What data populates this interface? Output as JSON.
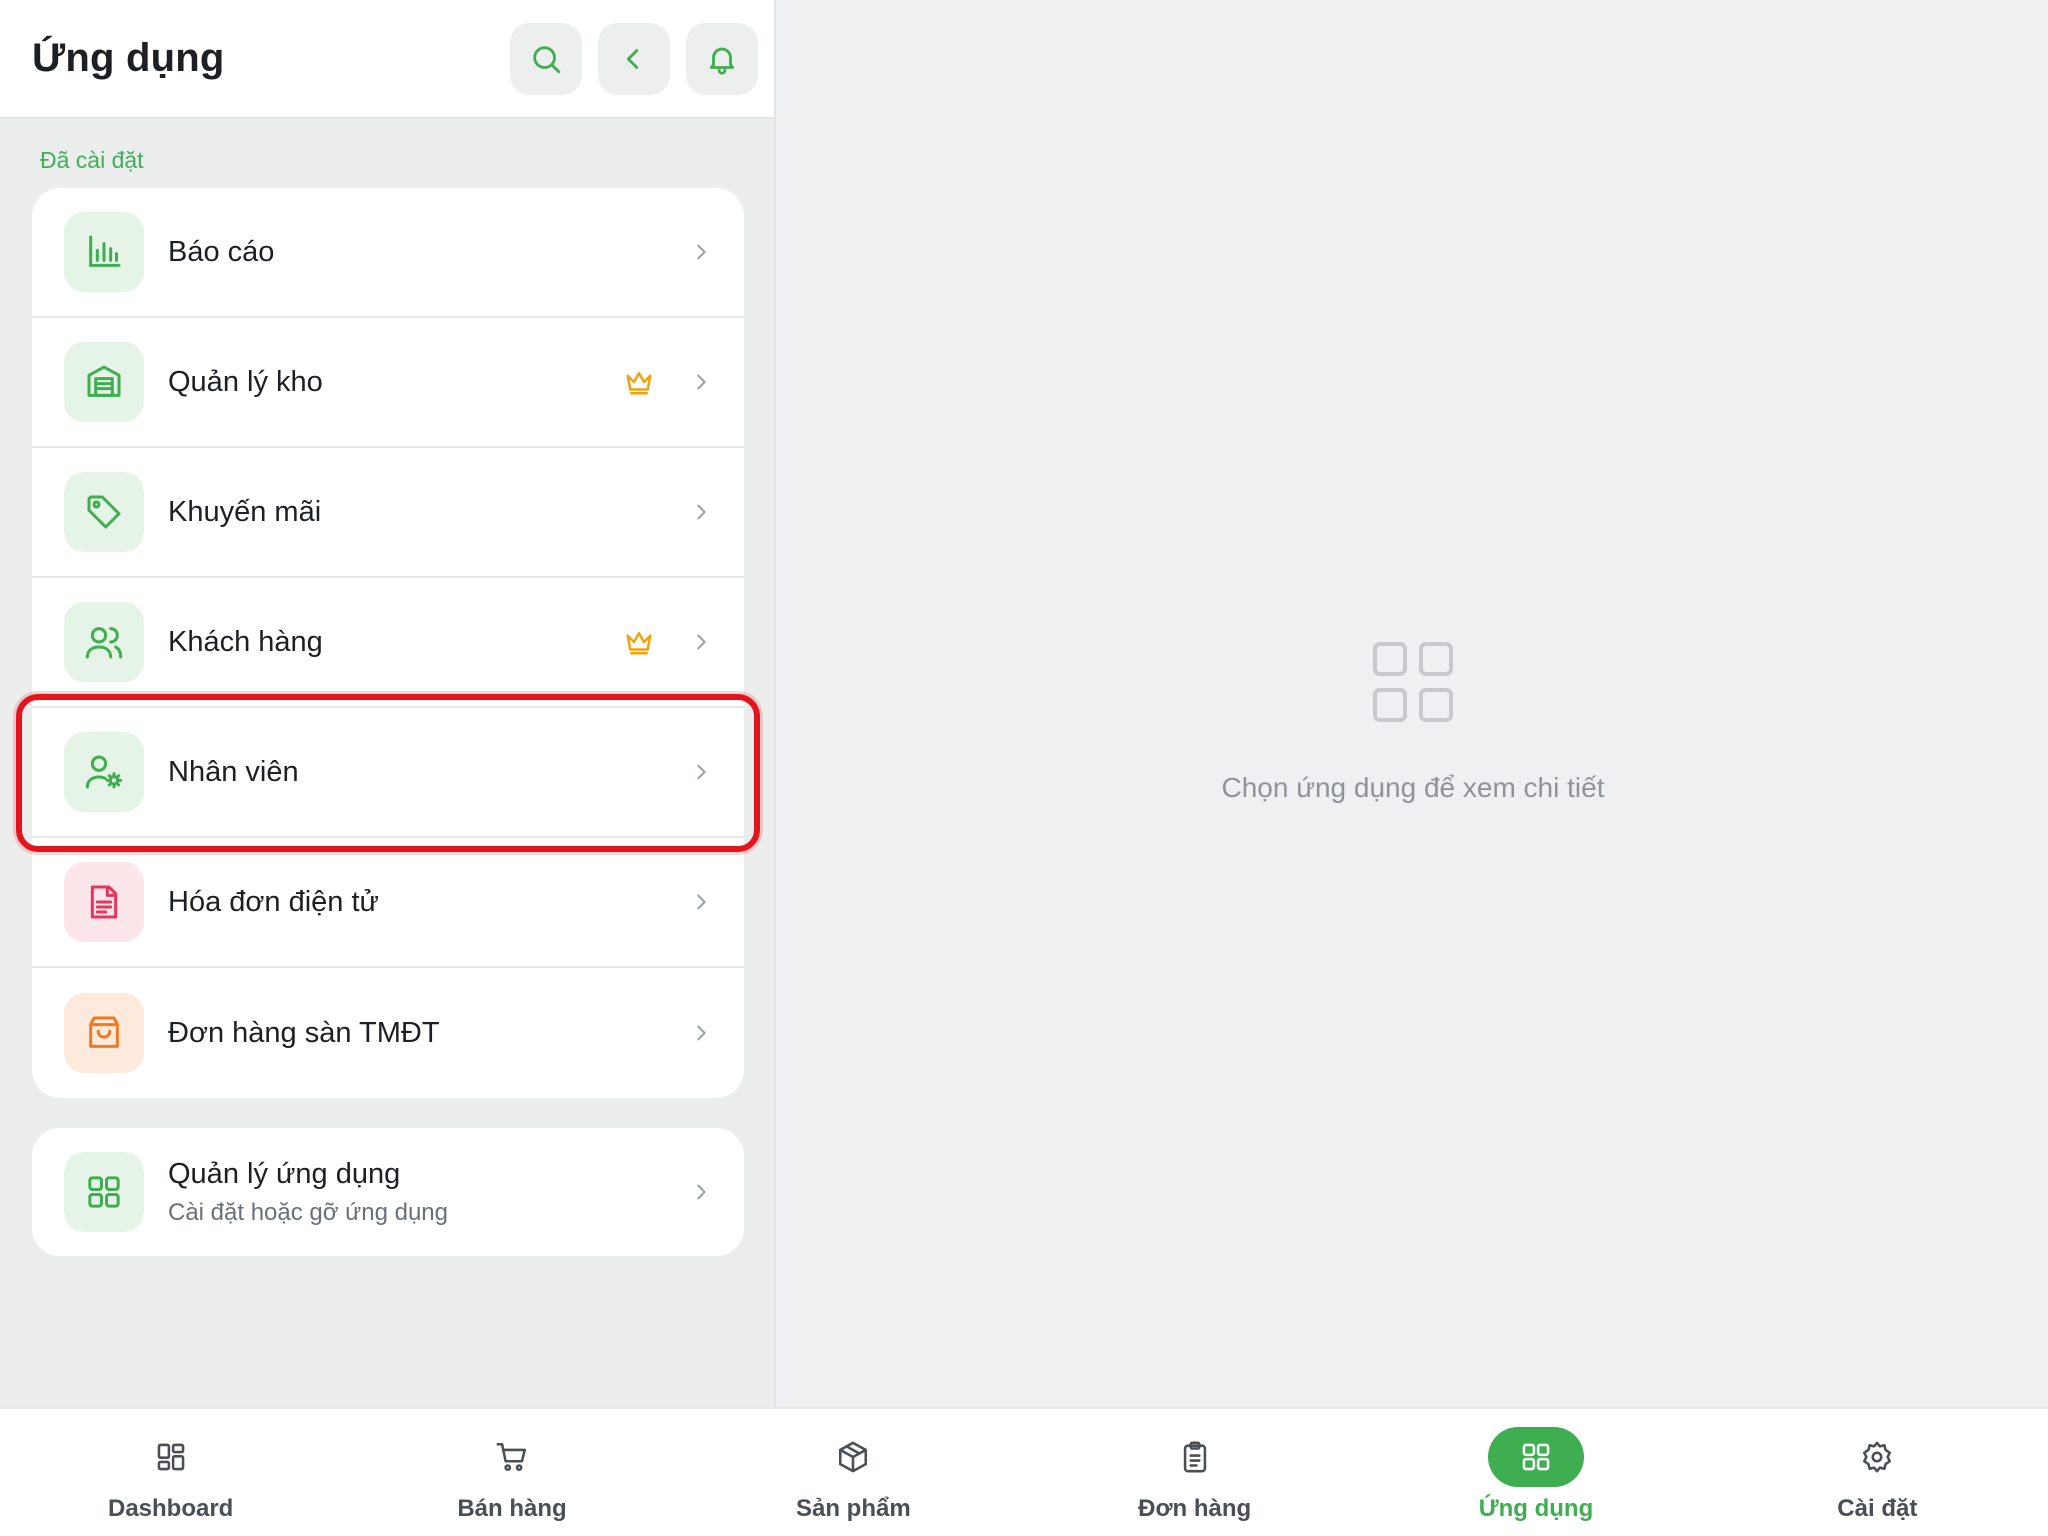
{
  "header": {
    "title": "Ứng dụng",
    "buttons": [
      "search-icon",
      "chevron-left-icon",
      "bell-icon"
    ]
  },
  "section_label": "Đã cài đặt",
  "apps": [
    {
      "label": "Báo cáo",
      "icon": "bar-chart-icon",
      "tint": "green",
      "premium": false
    },
    {
      "label": "Quản lý kho",
      "icon": "warehouse-icon",
      "tint": "green",
      "premium": true
    },
    {
      "label": "Khuyến mãi",
      "icon": "tag-icon",
      "tint": "green",
      "premium": false
    },
    {
      "label": "Khách hàng",
      "icon": "users-icon",
      "tint": "green",
      "premium": true
    },
    {
      "label": "Nhân viên",
      "icon": "user-settings-icon",
      "tint": "green",
      "premium": false
    },
    {
      "label": "Hóa đơn điện tử",
      "icon": "document-icon",
      "tint": "pink",
      "premium": false
    },
    {
      "label": "Đơn hàng sàn TMĐT",
      "icon": "shopping-bag-icon",
      "tint": "orange",
      "premium": false
    }
  ],
  "manage": {
    "title": "Quản lý ứng dụng",
    "subtitle": "Cài đặt hoặc gỡ ứng dụng",
    "icon": "grid-icon"
  },
  "empty_state": {
    "text": "Chọn ứng dụng để xem chi tiết",
    "icon": "grid-icon"
  },
  "bottom_nav": [
    {
      "label": "Dashboard",
      "icon": "dashboard-icon",
      "active": false
    },
    {
      "label": "Bán hàng",
      "icon": "cart-icon",
      "active": false
    },
    {
      "label": "Sản phẩm",
      "icon": "box-icon",
      "active": false
    },
    {
      "label": "Đơn hàng",
      "icon": "clipboard-icon",
      "active": false
    },
    {
      "label": "Ứng dụng",
      "icon": "grid-icon",
      "active": true
    },
    {
      "label": "Cài đặt",
      "icon": "gear-icon",
      "active": false
    }
  ],
  "colors": {
    "accent": "#3fae50",
    "highlight": "#e3141c",
    "crown": "#f2a20c",
    "pink": "#e8345a",
    "orange": "#f07a22"
  }
}
